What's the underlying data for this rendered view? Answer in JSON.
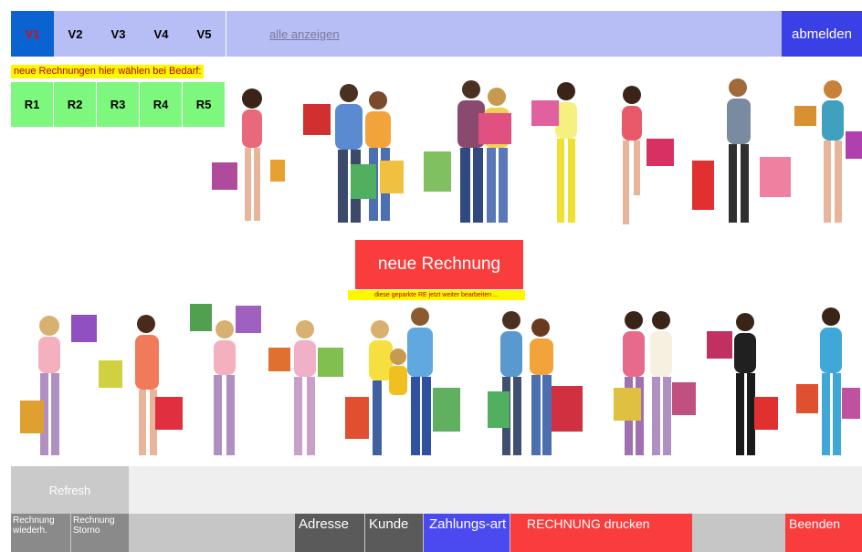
{
  "nav": {
    "tabs": [
      {
        "label": "V1",
        "active": true
      },
      {
        "label": "V2",
        "active": false
      },
      {
        "label": "V3",
        "active": false
      },
      {
        "label": "V4",
        "active": false
      },
      {
        "label": "V5",
        "active": false
      }
    ],
    "show_all_label": "alle anzeigen",
    "logout_label": "abmelden"
  },
  "invoices": {
    "hint": "neue Rechnungen hier wählen bei Bedarf:",
    "buttons": [
      "R1",
      "R2",
      "R3",
      "R4",
      "R5"
    ]
  },
  "main": {
    "new_invoice_label": "neue Rechnung",
    "edit_hint": "diese geparkte RE jetzt weiter bearbeiten ..."
  },
  "refresh_label": "Refresh",
  "toolbar": {
    "reprint_label": "Rechnung wiederh.",
    "cancel_label": "Rechnung Storno",
    "address_label": "Adresse",
    "customer_label": "Kunde",
    "payment_label": "Zahlungs-art",
    "print_label": "RECHNUNG drucken",
    "exit_label": "Beenden"
  },
  "colors": {
    "nav_bg": "#b7bdf5",
    "nav_active": "#0b63d1",
    "logout": "#3a3fe6",
    "r_buttons": "#7ef77e",
    "hint_bg": "#fdf700",
    "accent_red": "#f93c3c",
    "payment_blue": "#4a4af0"
  }
}
